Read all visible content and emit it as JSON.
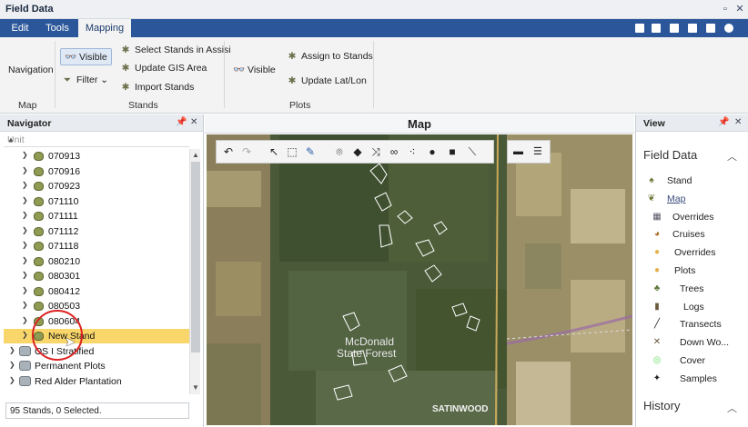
{
  "window": {
    "title": "Field Data"
  },
  "tabs": [
    {
      "label": "Edit"
    },
    {
      "label": "Tools"
    },
    {
      "label": "Mapping"
    }
  ],
  "ribbon": {
    "map_group": {
      "navigation_label": "Navigation",
      "group_label": "Map"
    },
    "stands_group": {
      "visible_label": "Visible",
      "filter_label": "Filter",
      "select_stands_label": "Select Stands in Assisi",
      "update_gis_label": "Update GIS Area",
      "import_stands_label": "Import Stands",
      "group_label": "Stands"
    },
    "plots_group": {
      "visible_label": "Visible",
      "assign_label": "Assign to Stands",
      "update_latlon_label": "Update Lat/Lon",
      "group_label": "Plots"
    }
  },
  "navigator": {
    "title": "Navigator",
    "column_header": "Unit",
    "items": [
      {
        "label": "070913"
      },
      {
        "label": "070916"
      },
      {
        "label": "070923"
      },
      {
        "label": "071110"
      },
      {
        "label": "071111"
      },
      {
        "label": "071112"
      },
      {
        "label": "071118"
      },
      {
        "label": "080210"
      },
      {
        "label": "080301"
      },
      {
        "label": "080412"
      },
      {
        "label": "080503"
      },
      {
        "label": "080604"
      },
      {
        "label": "New Stand"
      }
    ],
    "groups": [
      {
        "label": "OS I Stratified"
      },
      {
        "label": "Permanent Plots"
      },
      {
        "label": "Red Alder Plantation"
      }
    ],
    "status": "95 Stands, 0 Selected."
  },
  "map": {
    "title": "Map",
    "labels": {
      "forest_line1": "McDonald",
      "forest_line2": "State Forest",
      "place": "SATINWOOD"
    }
  },
  "view": {
    "title": "View",
    "field_data_title": "Field Data",
    "items": [
      {
        "label": "Stand",
        "icon": "stand-icon"
      },
      {
        "label": "Map",
        "icon": "map-icon"
      },
      {
        "label": "Overrides",
        "icon": "overrides-icon"
      },
      {
        "label": "Cruises",
        "icon": "cruises-icon"
      },
      {
        "label": "Overrides",
        "icon": "plot-overrides-icon"
      },
      {
        "label": "Plots",
        "icon": "plots-icon"
      },
      {
        "label": "Trees",
        "icon": "trees-icon"
      },
      {
        "label": "Logs",
        "icon": "logs-icon"
      },
      {
        "label": "Transects",
        "icon": "transects-icon"
      },
      {
        "label": "Down Wo...",
        "icon": "down-wood-icon"
      },
      {
        "label": "Cover",
        "icon": "cover-icon"
      },
      {
        "label": "Samples",
        "icon": "samples-icon"
      }
    ],
    "history_title": "History"
  },
  "colors": {
    "accent": "#2b579a",
    "selection": "#f8d66a",
    "highlight_ring": "#dd2222"
  }
}
